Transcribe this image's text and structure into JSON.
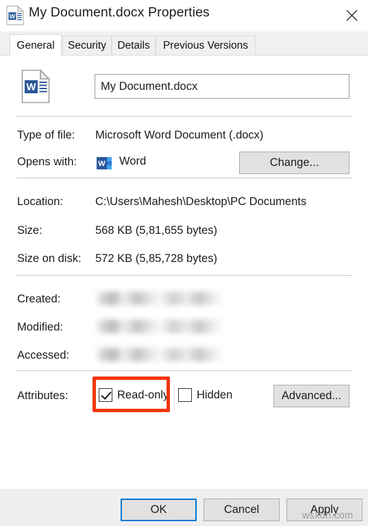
{
  "window": {
    "title": "My Document.docx Properties",
    "icon": "word-document-icon",
    "close_label": "✕"
  },
  "tabs": [
    {
      "label": "General",
      "active": true
    },
    {
      "label": "Security",
      "active": false
    },
    {
      "label": "Details",
      "active": false
    },
    {
      "label": "Previous Versions",
      "active": false
    }
  ],
  "general": {
    "filename_value": "My Document.docx",
    "filename_placeholder": "File name",
    "rows": [
      {
        "label": "Type of file:",
        "value": "Microsoft Word Document (.docx)"
      },
      {
        "label": "Opens with:",
        "value": "Word"
      },
      {
        "label": "Location:",
        "value": "C:\\Users\\Mahesh\\Desktop\\PC Documents"
      },
      {
        "label": "Size:",
        "value": "568 KB (5,81,655 bytes)"
      },
      {
        "label": "Size on disk:",
        "value": "572 KB (5,85,728 bytes)"
      },
      {
        "label": "Created:",
        "value": ""
      },
      {
        "label": "Modified:",
        "value": ""
      },
      {
        "label": "Accessed:",
        "value": ""
      },
      {
        "label": "Attributes:",
        "value": ""
      }
    ],
    "change_button": "Change...",
    "advanced_button": "Advanced...",
    "attributes": {
      "label": "Attributes:",
      "readonly_label": "Read-only",
      "readonly_checked": true,
      "hidden_label": "Hidden",
      "hidden_checked": false
    }
  },
  "footer": {
    "ok_label": "OK",
    "cancel_label": "Cancel",
    "apply_label": "Apply"
  },
  "watermark": "wsxdn.com",
  "colors": {
    "annotation_red": "#f2370f",
    "focus_blue": "#0078d7",
    "word_blue": "#2b579a",
    "dialog_gray": "#efefef",
    "button_face": "#e1e1e1"
  }
}
